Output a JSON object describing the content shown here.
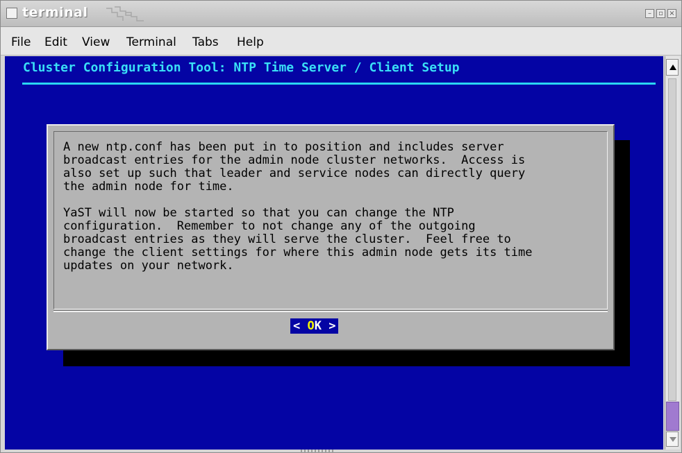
{
  "window": {
    "title": "terminal"
  },
  "menubar": {
    "items": [
      {
        "label": "File"
      },
      {
        "label": "Edit"
      },
      {
        "label": "View"
      },
      {
        "label": "Terminal"
      },
      {
        "label": "Tabs"
      },
      {
        "label": "Help"
      }
    ]
  },
  "terminal": {
    "header": "Cluster Configuration Tool: NTP Time Server / Client Setup",
    "dialog": {
      "message": "A new ntp.conf has been put in to position and includes server\nbroadcast entries for the admin node cluster networks.  Access is\nalso set up such that leader and service nodes can directly query\nthe admin node for time.\n\nYaST will now be started so that you can change the NTP\nconfiguration.  Remember to not change any of the outgoing\nbroadcast entries as they will serve the cluster.  Feel free to\nchange the client settings for where this admin node gets its time\nupdates on your network.",
      "ok_left": "< ",
      "ok_hot": "O",
      "ok_rest": "K >"
    }
  },
  "colors": {
    "terminal_bg": "#0404a4",
    "header_text": "#3ae0f6",
    "dialog_bg": "#b4b4b4",
    "shadow": "#000000",
    "hotkey": "#f8f800",
    "scroll_thumb": "#a07ad0"
  },
  "icons": {
    "window_controls": [
      "minimize-icon",
      "maximize-icon",
      "close-icon"
    ],
    "scrollbar": [
      "scroll-up-arrow-icon",
      "scroll-down-arrow-icon"
    ]
  }
}
